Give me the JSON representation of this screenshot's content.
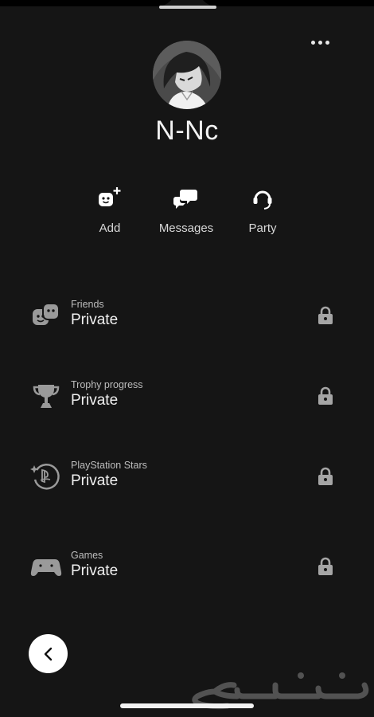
{
  "profile": {
    "username": "N-Nc"
  },
  "actions": [
    {
      "label": "Add",
      "icon": "add-friend-icon"
    },
    {
      "label": "Messages",
      "icon": "messages-icon"
    },
    {
      "label": "Party",
      "icon": "party-headset-icon"
    }
  ],
  "sections": [
    {
      "title": "Friends",
      "value": "Private",
      "icon": "friends-icon"
    },
    {
      "title": "Trophy progress",
      "value": "Private",
      "icon": "trophy-icon"
    },
    {
      "title": "PlayStation Stars",
      "value": "Private",
      "icon": "playstation-stars-icon"
    },
    {
      "title": "Games",
      "value": "Private",
      "icon": "controller-icon"
    }
  ],
  "watermark": {
    "text": "حراج"
  },
  "colors": {
    "background": "#151515",
    "text": "#f1f1f1",
    "subtext": "#bdbdbd",
    "icon": "#9a9a9a"
  }
}
